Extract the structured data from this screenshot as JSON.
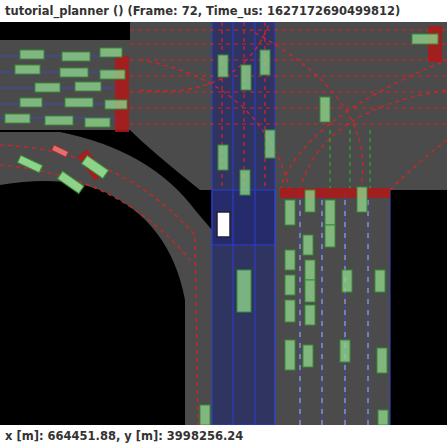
{
  "window": {
    "title": "tutorial_planner () (Frame: 72, Time_us: 1627172690499812)"
  },
  "status_bar": {
    "text": "x [m]: 664451.88, y [m]: 3998256.24"
  }
}
